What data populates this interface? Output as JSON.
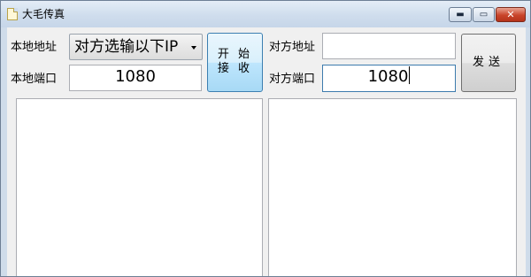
{
  "window": {
    "title": "大毛传真"
  },
  "titlebar_buttons": {
    "minimize": "▬",
    "maximize": "▭",
    "close": "✕"
  },
  "local": {
    "address_label": "本地地址",
    "address_value": "对方选输以下IP",
    "port_label": "本地端口",
    "port_value": "1080"
  },
  "start_button": {
    "line1": "开 始",
    "line2": "接 收"
  },
  "remote": {
    "address_label": "对方地址",
    "address_value": "",
    "port_label": "对方端口",
    "port_value": "1080"
  },
  "send_button": {
    "label": "发送"
  },
  "panels": {
    "received": "",
    "to_send": ""
  }
}
